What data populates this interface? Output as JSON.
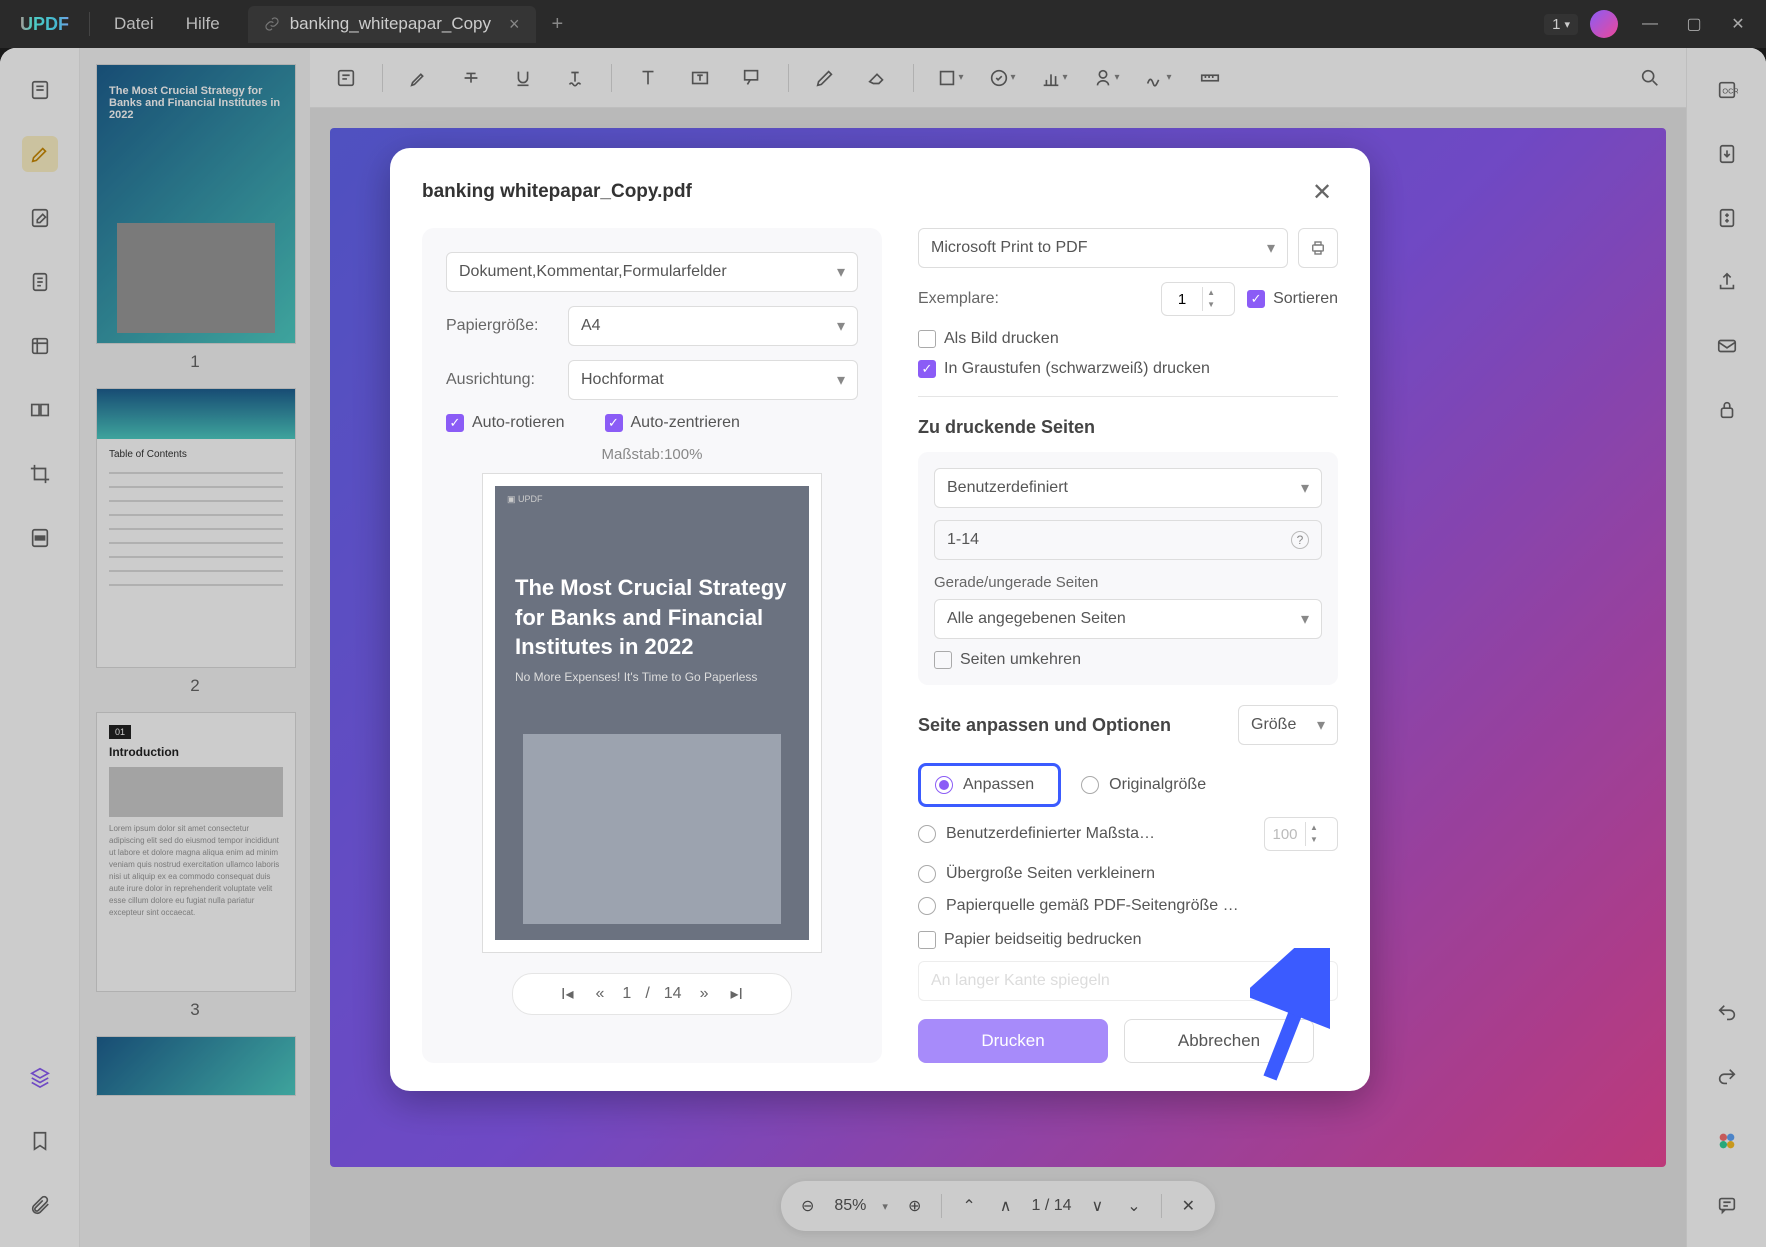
{
  "titlebar": {
    "logo": "UPDF",
    "menu_file": "Datei",
    "menu_help": "Hilfe",
    "tab_name": "banking_whitepapar_Copy",
    "page_indicator": "1"
  },
  "thumbs": {
    "n1": "1",
    "n2": "2",
    "n3": "3"
  },
  "thumb1": {
    "title": "The Most Crucial Strategy for Banks and Financial Institutes in 2022"
  },
  "toc_label": "Table of Contents",
  "bottombar": {
    "zoom": "85%",
    "page": "1 / 14"
  },
  "dialog": {
    "title": "banking whitepapar_Copy.pdf",
    "scope": "Dokument,Kommentar,Formularfelder",
    "paper_label": "Papiergröße:",
    "paper_value": "A4",
    "orient_label": "Ausrichtung:",
    "orient_value": "Hochformat",
    "auto_rotate": "Auto-rotieren",
    "auto_center": "Auto-zentrieren",
    "scale_label": "Maßstab:100%",
    "preview_title": "The Most Crucial Strategy for Banks and Financial Institutes in 2022",
    "preview_sub": "No More Expenses! It's Time to Go Paperless",
    "pager_current": "1",
    "pager_sep": "/",
    "pager_total": "14",
    "printer": "Microsoft Print to PDF",
    "copies_label": "Exemplare:",
    "copies_value": "1",
    "sort_label": "Sortieren",
    "print_as_image": "Als Bild drucken",
    "grayscale": "In Graustufen (schwarzweiß) drucken",
    "pages_section": "Zu druckende Seiten",
    "range_mode": "Benutzerdefiniert",
    "range_value": "1-14",
    "odd_even_label": "Gerade/ungerade Seiten",
    "odd_even_value": "Alle angegebenen Seiten",
    "reverse": "Seiten umkehren",
    "fit_section": "Seite anpassen und Optionen",
    "size_mode": "Größe",
    "fit": "Anpassen",
    "original": "Originalgröße",
    "custom_scale": "Benutzerdefinierter Maßstab ...",
    "custom_scale_value": "100",
    "shrink": "Übergroße Seiten verkleinern",
    "paper_source": "Papierquelle gemäß PDF-Seitengröße au...",
    "duplex": "Papier beidseitig bedrucken",
    "flip": "An langer Kante spiegeln",
    "print_btn": "Drucken",
    "cancel_btn": "Abbrechen"
  }
}
